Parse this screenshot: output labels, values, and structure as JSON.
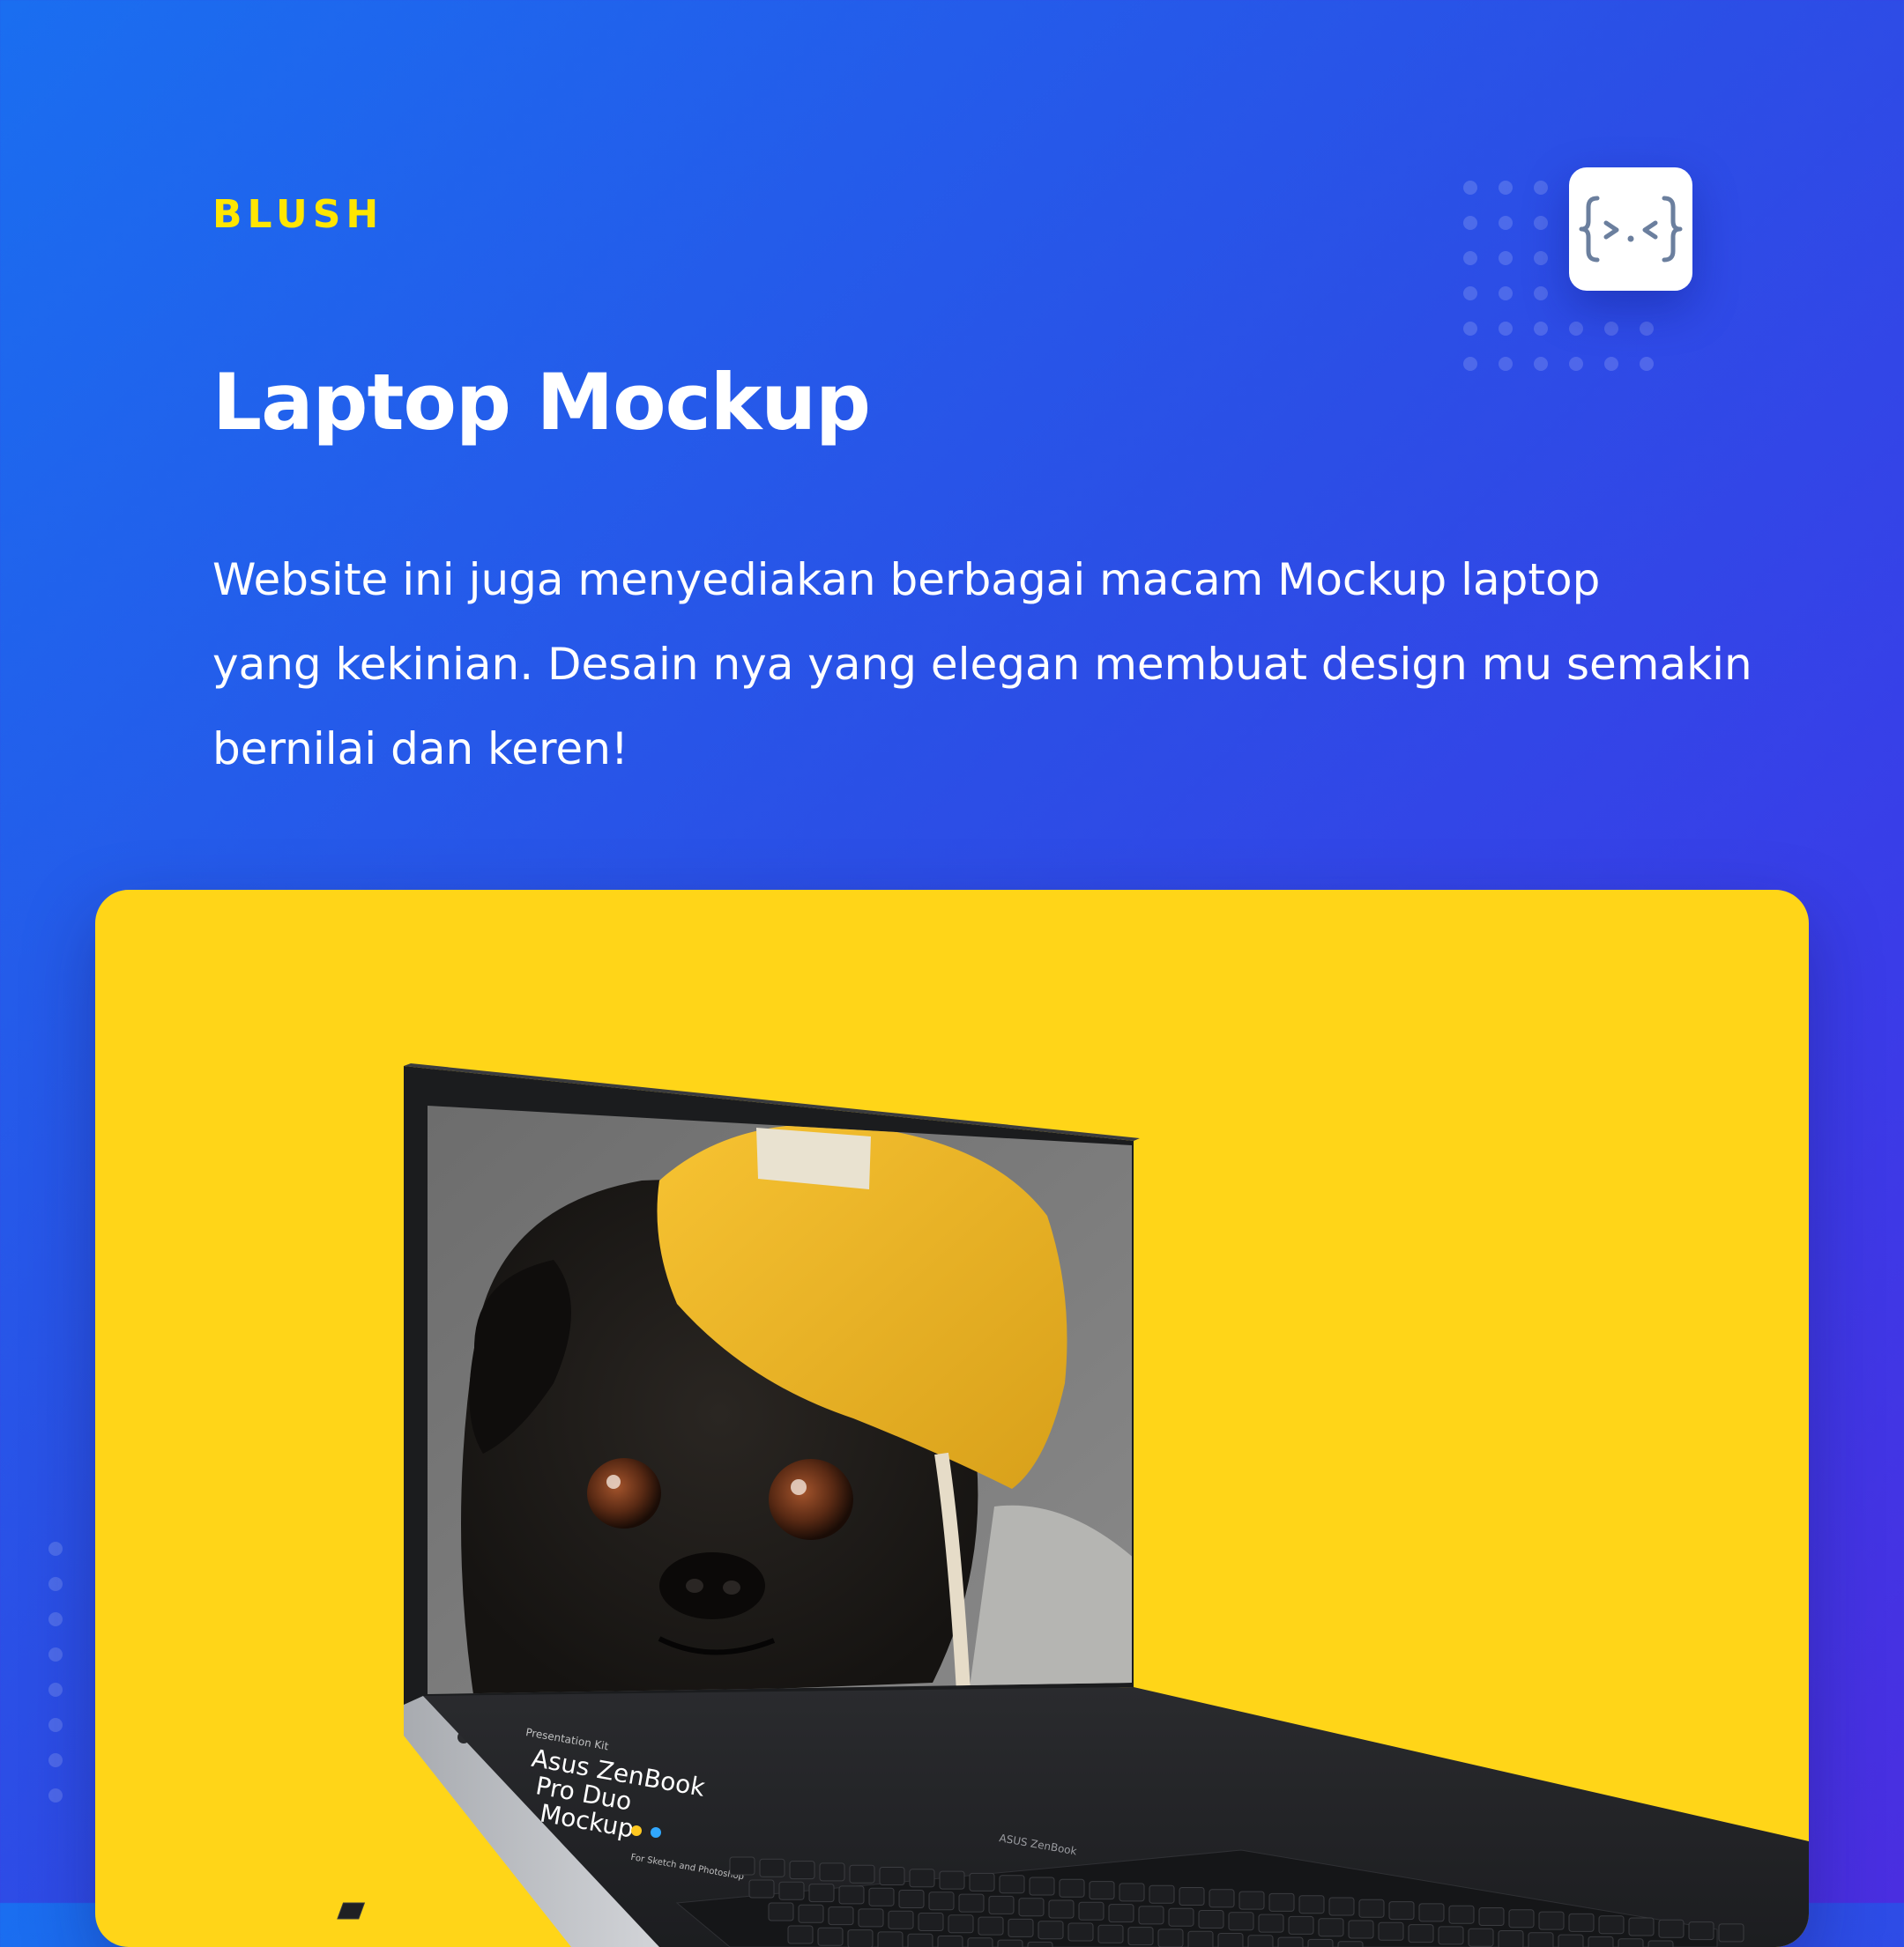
{
  "brand": "BLUSH",
  "title": "Laptop Mockup",
  "description": {
    "line1": "Website ini juga menyediakan berbagai macam Mockup laptop",
    "line2": "yang kekinian. Desain nya yang elegan membuat design mu semakin",
    "line3": "bernilai dan keren!"
  },
  "logo": {
    "glyph": "{>.<}",
    "icon": "code-face-icon"
  },
  "laptop": {
    "deck_text": {
      "kicker": "Presentation Kit",
      "line1": "Asus ZenBook",
      "line2": "Pro Duo",
      "line3": "Mockup",
      "small": "For Sketch and Photoshop"
    },
    "hinge_label": "ASUS ZenBook",
    "screen_image": "pug-in-yellow-beanie"
  },
  "colors": {
    "brand_yellow": "#ffe600",
    "card_yellow": "#ffd518",
    "gradient_start": "#1a6ef0",
    "gradient_end": "#4a2ee0"
  }
}
